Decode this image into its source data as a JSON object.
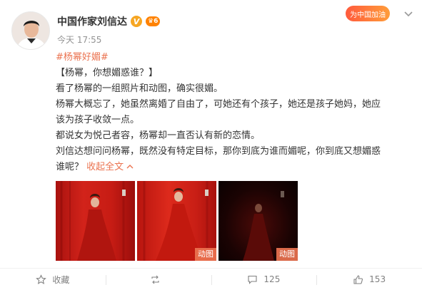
{
  "header": {
    "author_name": "中国作家刘信达",
    "verified_badge": "V",
    "level_badge": "6",
    "timestamp": "今天 17:55",
    "promo_badge": "为中国加油"
  },
  "post": {
    "hashtag": "#杨幂好媚#",
    "lines": [
      "【杨幂，你想媚惑谁？】",
      "看了杨幂的一组照片和动图，确实很媚。",
      "杨幂大概忘了，她虽然离婚了自由了，可她还有个孩子，她还是孩子她妈，她应",
      "该为孩子收敛一点。",
      "都说女为悦己者容，杨幂却一直否认有新的恋情。",
      "刘信达想问问杨幂，既然没有特定目标，那你到底为谁而媚呢，你到底又想媚惑"
    ],
    "last_line": "谁呢？",
    "collapse_label": "收起全文"
  },
  "media": [
    {
      "tag": ""
    },
    {
      "tag": "动图"
    },
    {
      "tag": "动图"
    }
  ],
  "footer": {
    "favorite_label": "收藏",
    "repost_count": "",
    "comment_count": "125",
    "like_count": "153"
  },
  "colors": {
    "accent": "#eb7350",
    "text": "#333333",
    "muted": "#808080"
  }
}
